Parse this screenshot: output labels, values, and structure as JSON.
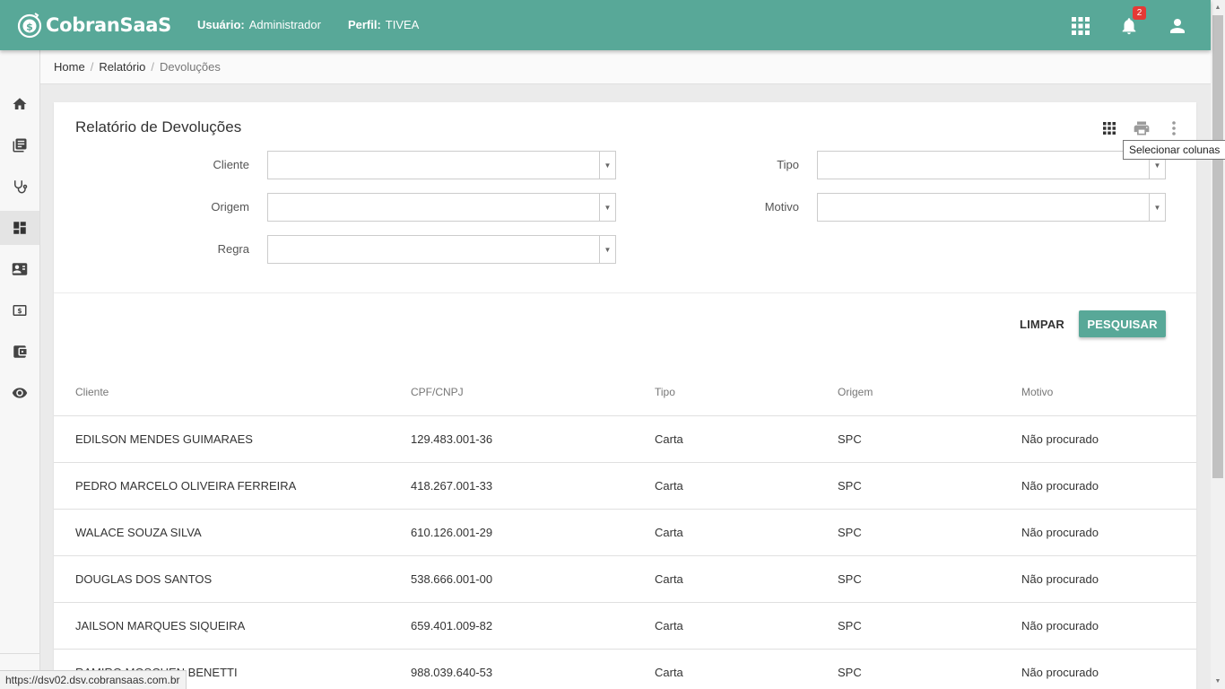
{
  "app": {
    "name": "CobranSaaS"
  },
  "header": {
    "user_label": "Usuário:",
    "user_value": "Administrador",
    "profile_label": "Perfil:",
    "profile_value": "TIVEA",
    "notification_count": "2",
    "icons": [
      "apps-grid-icon",
      "bell-icon",
      "account-icon"
    ]
  },
  "sidebar": {
    "items": [
      {
        "icon": "home-icon"
      },
      {
        "icon": "library-books-icon"
      },
      {
        "icon": "stethoscope-icon"
      },
      {
        "icon": "dashboard-icon",
        "active": true
      },
      {
        "icon": "contact-card-icon"
      },
      {
        "icon": "money-icon"
      },
      {
        "icon": "wallet-icon"
      },
      {
        "icon": "eye-icon"
      }
    ]
  },
  "breadcrumb": {
    "home": "Home",
    "report": "Relatório",
    "current": "Devoluções",
    "separator": "/"
  },
  "page": {
    "title": "Relatório de Devoluções",
    "tooltip": "Selecionar colunas"
  },
  "filters": {
    "cliente": {
      "label": "Cliente",
      "value": ""
    },
    "origem": {
      "label": "Origem",
      "value": ""
    },
    "regra": {
      "label": "Regra",
      "value": ""
    },
    "tipo": {
      "label": "Tipo",
      "value": ""
    },
    "motivo": {
      "label": "Motivo",
      "value": ""
    }
  },
  "actions": {
    "clear": "LIMPAR",
    "search": "PESQUISAR"
  },
  "table": {
    "columns": [
      "Cliente",
      "CPF/CNPJ",
      "Tipo",
      "Origem",
      "Motivo"
    ],
    "rows": [
      [
        "EDILSON MENDES GUIMARAES",
        "129.483.001-36",
        "Carta",
        "SPC",
        "Não procurado"
      ],
      [
        "PEDRO MARCELO OLIVEIRA FERREIRA",
        "418.267.001-33",
        "Carta",
        "SPC",
        "Não procurado"
      ],
      [
        "WALACE SOUZA SILVA",
        "610.126.001-29",
        "Carta",
        "SPC",
        "Não procurado"
      ],
      [
        "DOUGLAS DOS SANTOS",
        "538.666.001-00",
        "Carta",
        "SPC",
        "Não procurado"
      ],
      [
        "JAILSON MARQUES SIQUEIRA",
        "659.401.009-82",
        "Carta",
        "SPC",
        "Não procurado"
      ],
      [
        "RAMIRO MOSCHEN BENETTI",
        "988.039.640-53",
        "Carta",
        "SPC",
        "Não procurado"
      ]
    ]
  },
  "status_url": "https://dsv02.dsv.cobransaas.com.br",
  "colors": {
    "primary": "#58a898",
    "badge": "#e53935",
    "icon": "#555555"
  }
}
